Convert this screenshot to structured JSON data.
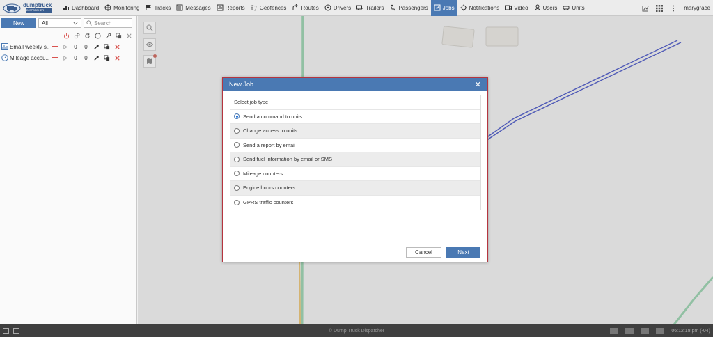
{
  "nav": {
    "items": [
      {
        "label": "Dashboard",
        "icon": "bar-chart-icon"
      },
      {
        "label": "Monitoring",
        "icon": "globe-icon"
      },
      {
        "label": "Tracks",
        "icon": "flag-icon"
      },
      {
        "label": "Messages",
        "icon": "messages-icon"
      },
      {
        "label": "Reports",
        "icon": "reports-icon"
      },
      {
        "label": "Geofences",
        "icon": "geofence-icon"
      },
      {
        "label": "Routes",
        "icon": "routes-icon"
      },
      {
        "label": "Drivers",
        "icon": "steering-wheel-icon"
      },
      {
        "label": "Trailers",
        "icon": "trailer-icon"
      },
      {
        "label": "Passengers",
        "icon": "passenger-icon"
      },
      {
        "label": "Jobs",
        "icon": "jobs-icon"
      },
      {
        "label": "Notifications",
        "icon": "bell-icon"
      },
      {
        "label": "Video",
        "icon": "video-icon"
      },
      {
        "label": "Users",
        "icon": "user-icon"
      },
      {
        "label": "Units",
        "icon": "car-icon"
      }
    ],
    "active_label": "Jobs",
    "user_name": "marygrace"
  },
  "logo": {
    "line1": "dumptruck",
    "line2": "DISPATCHER"
  },
  "left_panel": {
    "new_label": "New",
    "filter_value": "All",
    "search_placeholder": "Search",
    "jobs": [
      {
        "name": "Email weekly s...",
        "count1": "0",
        "count2": "0",
        "icon": "report-job-icon"
      },
      {
        "name": "Mileage accou...",
        "count1": "0",
        "count2": "0",
        "icon": "counter-job-icon"
      }
    ]
  },
  "dialog": {
    "title": "New Job",
    "caption": "Select job type",
    "options": [
      {
        "label": "Send a command to units",
        "selected": true
      },
      {
        "label": "Change access to units",
        "selected": false
      },
      {
        "label": "Send a report by email",
        "selected": false
      },
      {
        "label": "Send fuel information by email or SMS",
        "selected": false
      },
      {
        "label": "Mileage counters",
        "selected": false
      },
      {
        "label": "Engine hours counters",
        "selected": false
      },
      {
        "label": "GPRS traffic counters",
        "selected": false
      }
    ],
    "cancel_label": "Cancel",
    "next_label": "Next"
  },
  "footer": {
    "copyright": "© Dump Truck Dispatcher",
    "time": "06:12:18 pm (-04)"
  },
  "colors": {
    "accent": "#4a79b3",
    "dialog_border": "#b5353f",
    "danger": "#d9534f"
  }
}
